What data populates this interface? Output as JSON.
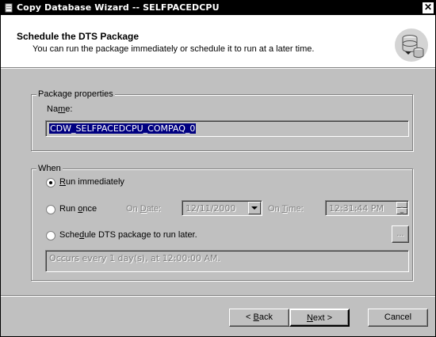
{
  "window": {
    "title": "Copy Database Wizard  -- SELFPACEDCPU",
    "close_glyph": "✕"
  },
  "header": {
    "title": "Schedule the DTS Package",
    "subtitle": "You can run the package immediately or schedule it to run at a later time.",
    "icon": "database-schedule-icon"
  },
  "package_properties": {
    "legend": "Package properties",
    "name_label_pre": "Na",
    "name_label_accel": "m",
    "name_label_post": "e:",
    "name_value": "CDW_SELFPACEDCPU_COMPAQ_0"
  },
  "when": {
    "legend": "When",
    "run_immediately": {
      "accel": "R",
      "rest": "un immediately",
      "selected": true
    },
    "run_once": {
      "pre": "Run ",
      "accel": "o",
      "rest": "nce",
      "selected": false
    },
    "on_date_label": {
      "pre": "On ",
      "accel": "D",
      "rest": "ate:"
    },
    "on_date_value": "12/11/2000",
    "on_time_label": {
      "pre": "On ",
      "accel": "T",
      "rest": "ime:"
    },
    "on_time_value": "12:31:44 PM",
    "schedule_later": {
      "pre": "Sche",
      "accel": "d",
      "rest": "ule DTS package to run later.",
      "selected": false
    },
    "ellipsis_label": "...",
    "schedule_text": "Occurs every 1 day(s), at 12:00:00 AM."
  },
  "buttons": {
    "back": {
      "pre": "< ",
      "accel": "B",
      "rest": "ack"
    },
    "next": {
      "accel": "N",
      "rest": "ext >"
    },
    "cancel": "Cancel"
  }
}
